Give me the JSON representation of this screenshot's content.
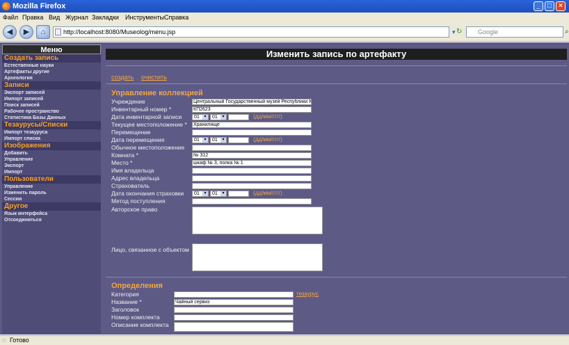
{
  "window": {
    "title": "Mozilla Firefox"
  },
  "menubar": [
    "Файл",
    "Правка",
    "Вид",
    "Журнал",
    "Закладки",
    "Инструменты",
    "Справка"
  ],
  "nav": {
    "url": "http://localhost:8080/Museolog/menu.jsp",
    "search_placeholder": "Google"
  },
  "sidebar": {
    "title": "Меню",
    "sections": [
      {
        "label": "Создать запись",
        "items": [
          "Естественные науки",
          "Артефакты другие",
          "Археология"
        ]
      },
      {
        "label": "Записи",
        "items": [
          "Экспорт записей",
          "Импорт записей",
          "Поиск записей",
          "Рабочее пространство",
          "Статистика Базы Данных"
        ]
      },
      {
        "label": "Тезаурусы/Списки",
        "items": [
          "Импорт тезауруса",
          "Импорт списка"
        ]
      },
      {
        "label": "Изображения",
        "items": [
          "Добавить",
          "Управление",
          "Экспорт",
          "Импорт"
        ]
      },
      {
        "label": "Пользователи",
        "items": [
          "Управление",
          "Изменить пароль",
          "Сессии"
        ]
      },
      {
        "label": "Другое",
        "items": [
          "Язык интерфейса",
          "Отсоединиться"
        ]
      }
    ]
  },
  "main": {
    "heading": "Изменить запись по артефакту",
    "links": {
      "create": "создать",
      "clear": "очистить"
    },
    "collection": {
      "title": "Управление коллекцией",
      "institution_label": "Учреждение",
      "institution_value": "Центральный Государственный музей Республики К",
      "inventory_label": "Инвентарный номер *",
      "inventory_value": "КП2623",
      "inv_date_label": "Дата инвентарной записи",
      "date_day": "01",
      "date_month": "01",
      "date_hint": "(дд/мм/гггг)",
      "location_label": "Текущее местоположение *",
      "location_value": "Хранилище",
      "movement_label": "Перемещение",
      "move_date_label": "Дата перемещения",
      "usual_location_label": "Обычное местоположение",
      "room_label": "Комната *",
      "room_value": "№ 312",
      "place_label": "Место *",
      "place_value": "шкаф № 3, полка № 1",
      "owner_name_label": "Имя владельца",
      "owner_address_label": "Адрес владельца",
      "insurer_label": "Страхователь",
      "insurance_end_label": "Дата окончания страховки",
      "acquisition_label": "Метод поступления",
      "copyright_label": "Авторское право",
      "persons_label": "Лицо, связанное с объектом"
    },
    "definitions": {
      "title": "Определения",
      "category_label": "Категория",
      "thesaurus_link": "тезаурус",
      "name_label": "Название *",
      "name_value": "Чайный сервиз",
      "header_label": "Заголовок",
      "set_number_label": "Номер комплекта",
      "set_description_label": "Описание комплекта"
    }
  },
  "status": {
    "text": "Готово"
  }
}
